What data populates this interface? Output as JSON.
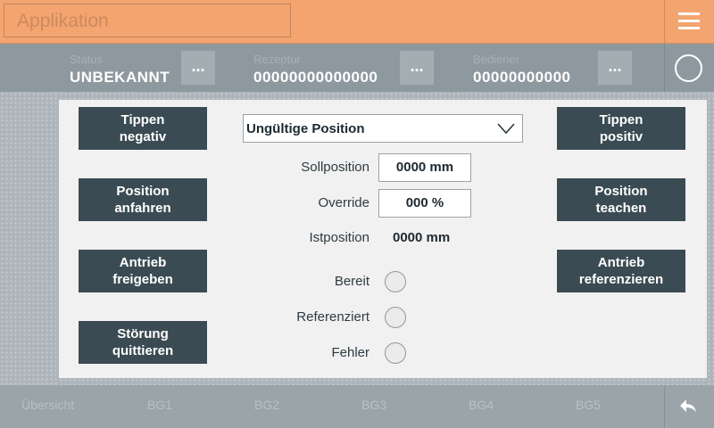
{
  "header": {
    "title": "Applikation",
    "menu_icon": "hamburger-icon"
  },
  "statusbar": {
    "status": {
      "label": "Status",
      "value": "UNBEKANNT"
    },
    "rezeptur": {
      "label": "Rezeptur",
      "value": "00000000000000"
    },
    "bediener": {
      "label": "Bediener",
      "value": "00000000000"
    },
    "more_label": "...",
    "indicator_icon": "circle-icon"
  },
  "left_buttons": [
    "Tippen\nnegativ",
    "Position\nanfahren",
    "Antrieb\nfreigeben",
    "Störung\nquittieren"
  ],
  "right_buttons": [
    "Tippen\npositiv",
    "Position\nteachen",
    "Antrieb\nreferenzieren"
  ],
  "position_select": {
    "value": "Ungültige Position"
  },
  "fields": {
    "sollposition": {
      "label": "Sollposition",
      "value": "0000 mm"
    },
    "override": {
      "label": "Override",
      "value": "000 %"
    },
    "istposition": {
      "label": "Istposition",
      "value": "0000 mm"
    }
  },
  "indicators": [
    {
      "label": "Bereit",
      "state": "off"
    },
    {
      "label": "Referenziert",
      "state": "off"
    },
    {
      "label": "Fehler",
      "state": "off"
    }
  ],
  "footer": {
    "tabs": [
      "Übersicht",
      "BG1",
      "BG2",
      "BG3",
      "BG4",
      "BG5"
    ],
    "back_icon": "back-arrow-icon"
  }
}
